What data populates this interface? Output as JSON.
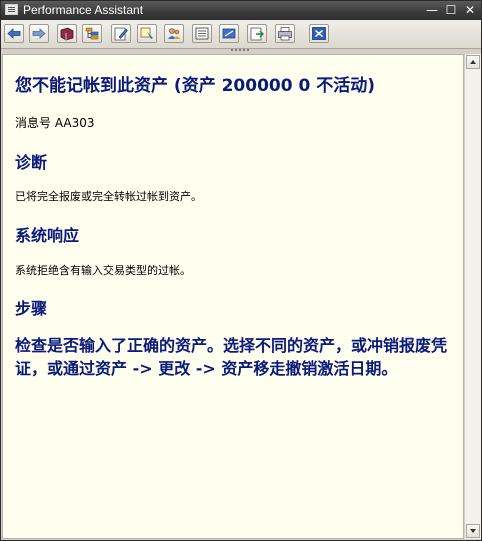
{
  "window": {
    "title": "Performance Assistant"
  },
  "title_buttons": {
    "minimize": "—",
    "maximize": "☐",
    "close": "✕"
  },
  "toolbar": {
    "buttons": [
      "back-icon",
      "forward-icon",
      "book-icon",
      "hierarchy-icon",
      "edit-icon",
      "notes-icon",
      "users-icon",
      "document-icon",
      "link-icon",
      "export-icon",
      "print-icon",
      "close-icon"
    ]
  },
  "content": {
    "heading": "您不能记帐到此资产 (资产 200000 0 不活动)",
    "message_number": "消息号 AA303",
    "sections": [
      {
        "title": "诊断",
        "text": "已将完全报废或完全转帐过帐到资产。"
      },
      {
        "title": "系统响应",
        "text": "系统拒绝含有输入交易类型的过帐。"
      },
      {
        "title": "步骤",
        "text": ""
      }
    ],
    "procedure_text": "检查是否输入了正确的资产。选择不同的资产，或冲销报废凭证，或通过资产 -> 更改 -> 资产移走撤销激活日期。"
  },
  "colors": {
    "heading": "#0b1a7a",
    "background": "#fffff0",
    "titlebar": "#3a3a3a"
  }
}
